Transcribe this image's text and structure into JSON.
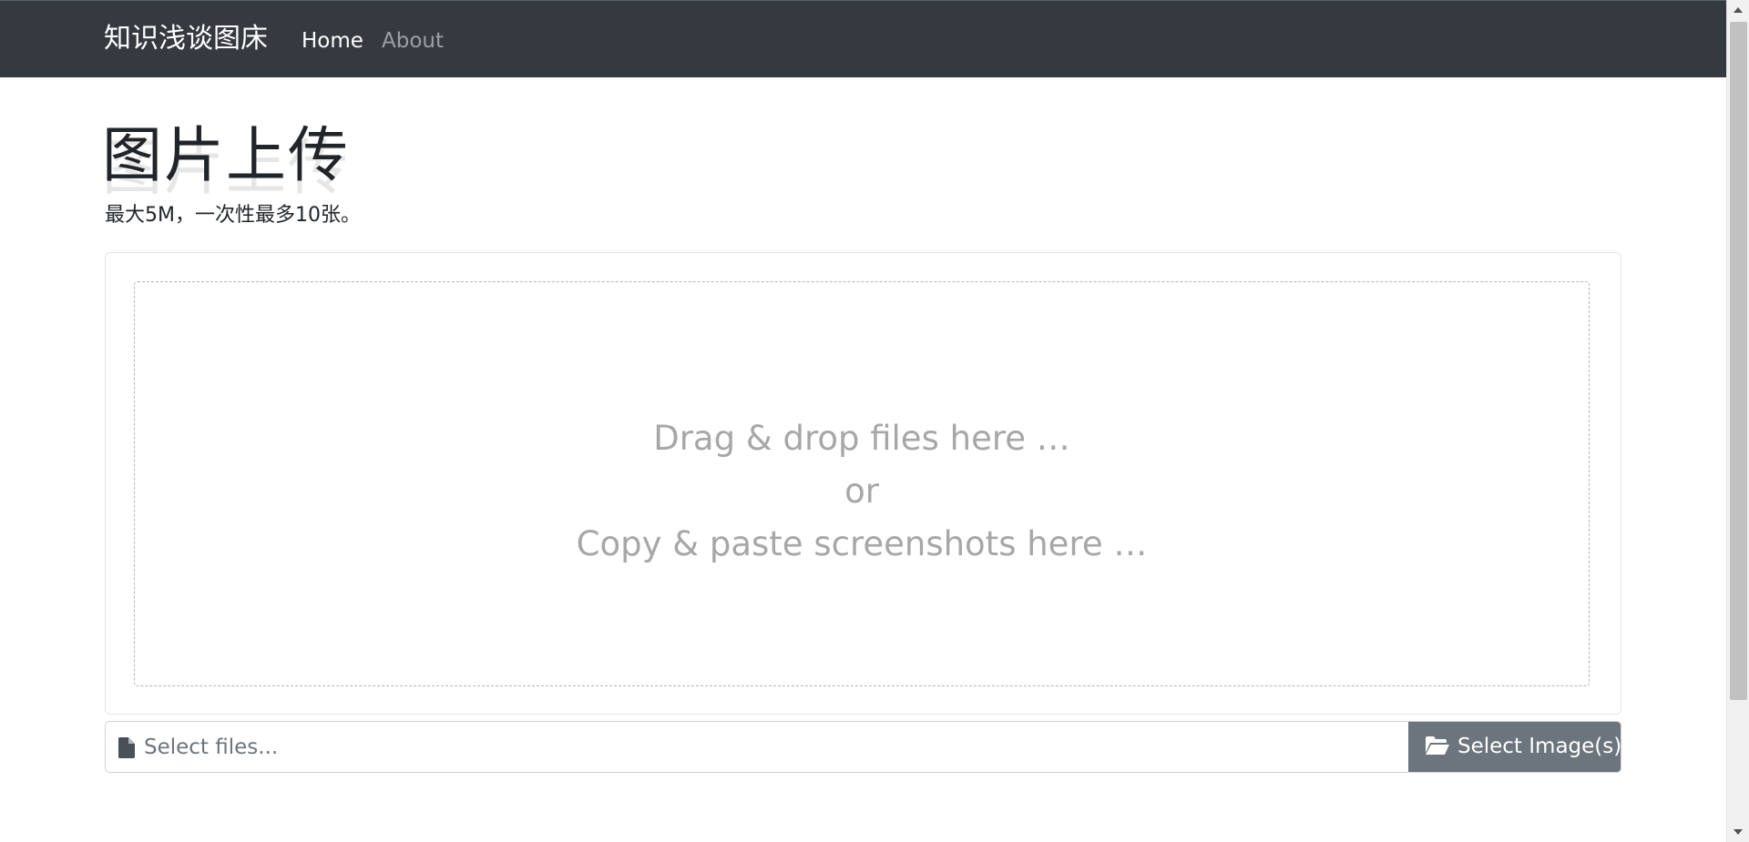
{
  "navbar": {
    "brand": "知识浅谈图床",
    "links": [
      {
        "label": "Home",
        "active": true
      },
      {
        "label": "About",
        "active": false
      }
    ]
  },
  "main": {
    "title": "图片上传",
    "subtitle": "最大5M，一次性最多10张。",
    "dropzone": {
      "line1": "Drag & drop files here …",
      "line2": "or",
      "line3": "Copy & paste screenshots here …"
    },
    "file_input": {
      "placeholder": "Select files...",
      "button_label": "Select Image(s)",
      "icon": "file-icon",
      "button_icon": "folder-open-icon"
    }
  },
  "colors": {
    "navbar_bg": "#343a40",
    "button_bg": "#6c757d",
    "drop_text": "#a7a7a7"
  }
}
